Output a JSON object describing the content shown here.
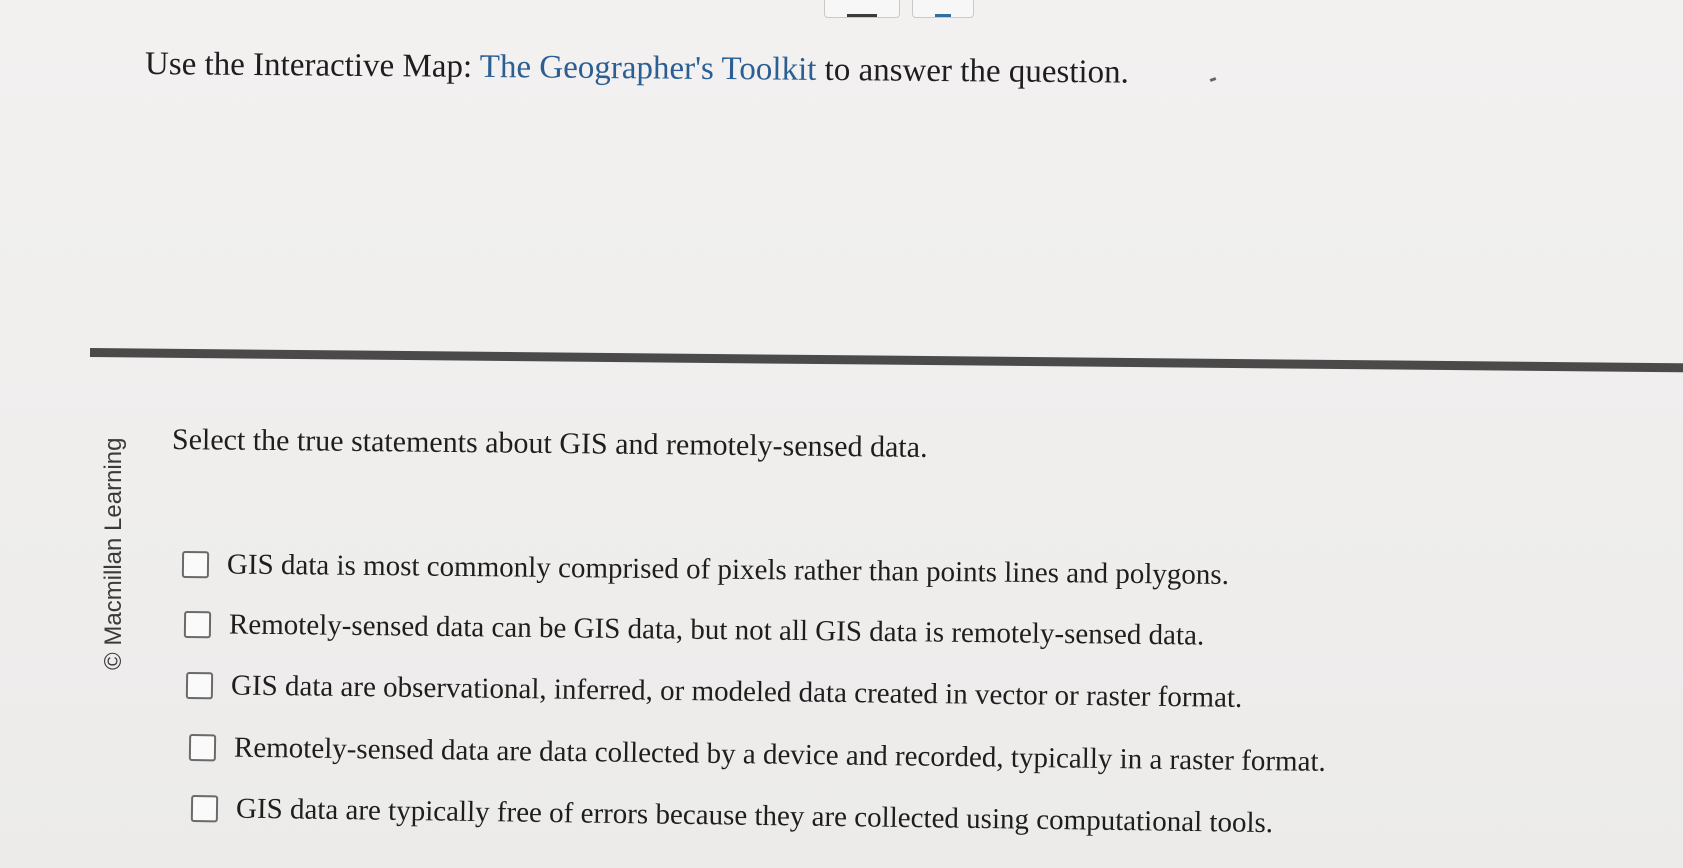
{
  "header": {
    "prefix": "Use the Interactive Map: ",
    "link_text": "The Geographer's Toolkit",
    "suffix": " to answer the question."
  },
  "credit": "© Macmillan Learning",
  "question": {
    "prompt": "Select the true statements about GIS and remotely-sensed data.",
    "options": [
      {
        "label": "GIS data is most commonly comprised of pixels rather than points lines and polygons.",
        "checked": false
      },
      {
        "label": "Remotely-sensed data can be GIS data, but not all GIS data is remotely-sensed data.",
        "checked": false
      },
      {
        "label": "GIS data are observational, inferred, or modeled data created in vector or raster format.",
        "checked": false
      },
      {
        "label": "Remotely-sensed data are data collected by a device and recorded, typically in a raster format.",
        "checked": false
      },
      {
        "label": "GIS data are typically free of errors because they are collected using computational tools.",
        "checked": false
      }
    ]
  },
  "colors": {
    "link": "#2b5f93",
    "divider": "#4a4a4a",
    "background": "#efeeed"
  }
}
